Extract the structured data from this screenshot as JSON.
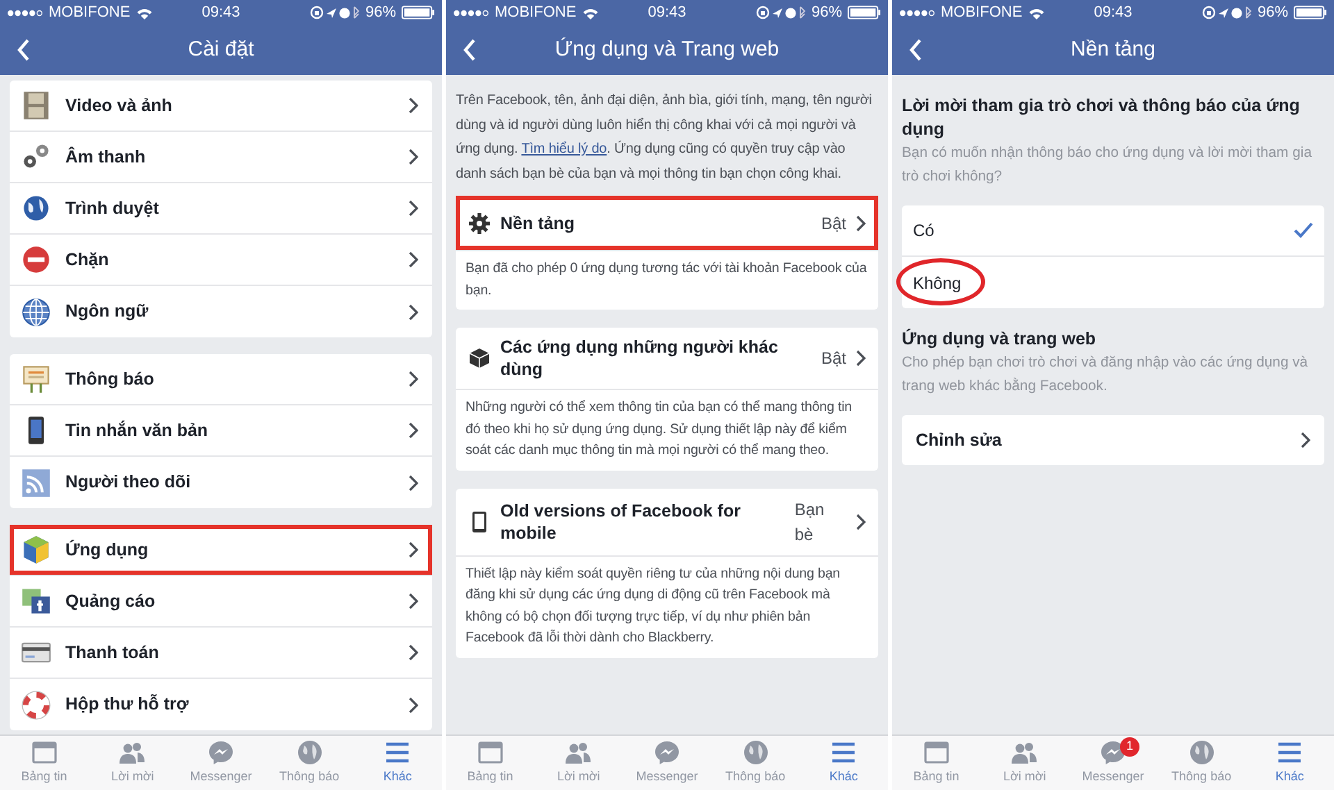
{
  "screens": [
    {
      "kind": "settings",
      "status_bar": {
        "carrier": "MOBIFONE",
        "time": "09:43",
        "battery": "96%"
      },
      "title": "Cài đặt",
      "groups": [
        {
          "items": [
            {
              "label": "Video và ảnh",
              "highlighted": false
            },
            {
              "label": "Âm thanh",
              "highlighted": false
            },
            {
              "label": "Trình duyệt",
              "highlighted": false
            },
            {
              "label": "Chặn",
              "highlighted": false
            },
            {
              "label": "Ngôn ngữ",
              "highlighted": false
            }
          ]
        },
        {
          "items": [
            {
              "label": "Thông báo",
              "highlighted": false
            },
            {
              "label": "Tin nhắn văn bản",
              "highlighted": false
            },
            {
              "label": "Người theo dõi",
              "highlighted": false
            }
          ]
        },
        {
          "items": [
            {
              "label": "Ứng dụng",
              "highlighted": true
            },
            {
              "label": "Quảng cáo",
              "highlighted": false
            },
            {
              "label": "Thanh toán",
              "highlighted": false
            },
            {
              "label": "Hộp thư hỗ trợ",
              "highlighted": false
            }
          ]
        }
      ],
      "tab_bar": [
        {
          "label": "Bảng tin",
          "selected": false
        },
        {
          "label": "Lời mời",
          "selected": false
        },
        {
          "label": "Messenger",
          "selected": false
        },
        {
          "label": "Thông báo",
          "selected": false
        },
        {
          "label": "Khác",
          "selected": true
        }
      ]
    },
    {
      "kind": "cards",
      "status_bar": {
        "carrier": "MOBIFONE",
        "time": "09:43",
        "battery": "96%"
      },
      "title": "Ứng dụng và Trang web",
      "intro": {
        "text_before": "Trên Facebook, tên, ảnh đại diện, ảnh bìa, giới tính, mạng, tên người dùng và id người dùng luôn hiển thị công khai với cả mọi người và ứng dụng. ",
        "link": "Tìm hiểu lý do",
        "text_after": ". Ứng dụng cũng có quyền truy cập vào danh sách bạn bè của bạn và mọi thông tin bạn chọn công khai."
      },
      "cards": [
        {
          "title": "Nền tảng",
          "value": "Bật",
          "highlighted": true,
          "description": "Bạn đã cho phép 0 ứng dụng tương tác với tài khoản Facebook của bạn."
        },
        {
          "title": "Các ứng dụng những người khác dùng",
          "value": "Bật",
          "highlighted": false,
          "description": "Những người có thể xem thông tin của bạn có thể mang thông tin đó theo khi họ sử dụng ứng dụng. Sử dụng thiết lập này để kiểm soát các danh mục thông tin mà mọi người có thể mang theo."
        },
        {
          "title": "Old versions of Facebook for mobile",
          "value": "Bạn bè",
          "highlighted": false,
          "description": "Thiết lập này kiểm soát quyền riêng tư của những nội dung bạn đăng khi sử dụng các ứng dụng di động cũ trên Facebook mà không có bộ chọn đối tượng trực tiếp, ví dụ như phiên bản Facebook đã lỗi thời dành cho Blackberry."
        }
      ],
      "tab_bar": [
        {
          "label": "Bảng tin",
          "selected": false
        },
        {
          "label": "Lời mời",
          "selected": false
        },
        {
          "label": "Messenger",
          "selected": false
        },
        {
          "label": "Thông báo",
          "selected": false
        },
        {
          "label": "Khác",
          "selected": true
        }
      ]
    },
    {
      "kind": "choice",
      "status_bar": {
        "carrier": "MOBIFONE",
        "time": "09:43",
        "battery": "96%"
      },
      "title": "Nền tảng",
      "question": {
        "heading": "Lời mời tham gia trò chơi và thông báo của ứng dụng",
        "description": "Bạn có muốn nhận thông báo cho ứng dụng và lời mời tham gia trò chơi không?"
      },
      "options": [
        {
          "label": "Có",
          "selected": true,
          "circled": false
        },
        {
          "label": "Không",
          "selected": false,
          "circled": true
        }
      ],
      "apps_section": {
        "heading": "Ứng dụng và trang web",
        "description": "Cho phép bạn chơi trò chơi và đăng nhập vào các ứng dụng và trang web khác bằng Facebook."
      },
      "edit_row": {
        "label": "Chỉnh sửa"
      },
      "tab_bar": [
        {
          "label": "Bảng tin",
          "selected": false
        },
        {
          "label": "Lời mời",
          "selected": false
        },
        {
          "label": "Messenger",
          "selected": false,
          "badge": "1"
        },
        {
          "label": "Thông báo",
          "selected": false
        },
        {
          "label": "Khác",
          "selected": true
        }
      ]
    }
  ]
}
